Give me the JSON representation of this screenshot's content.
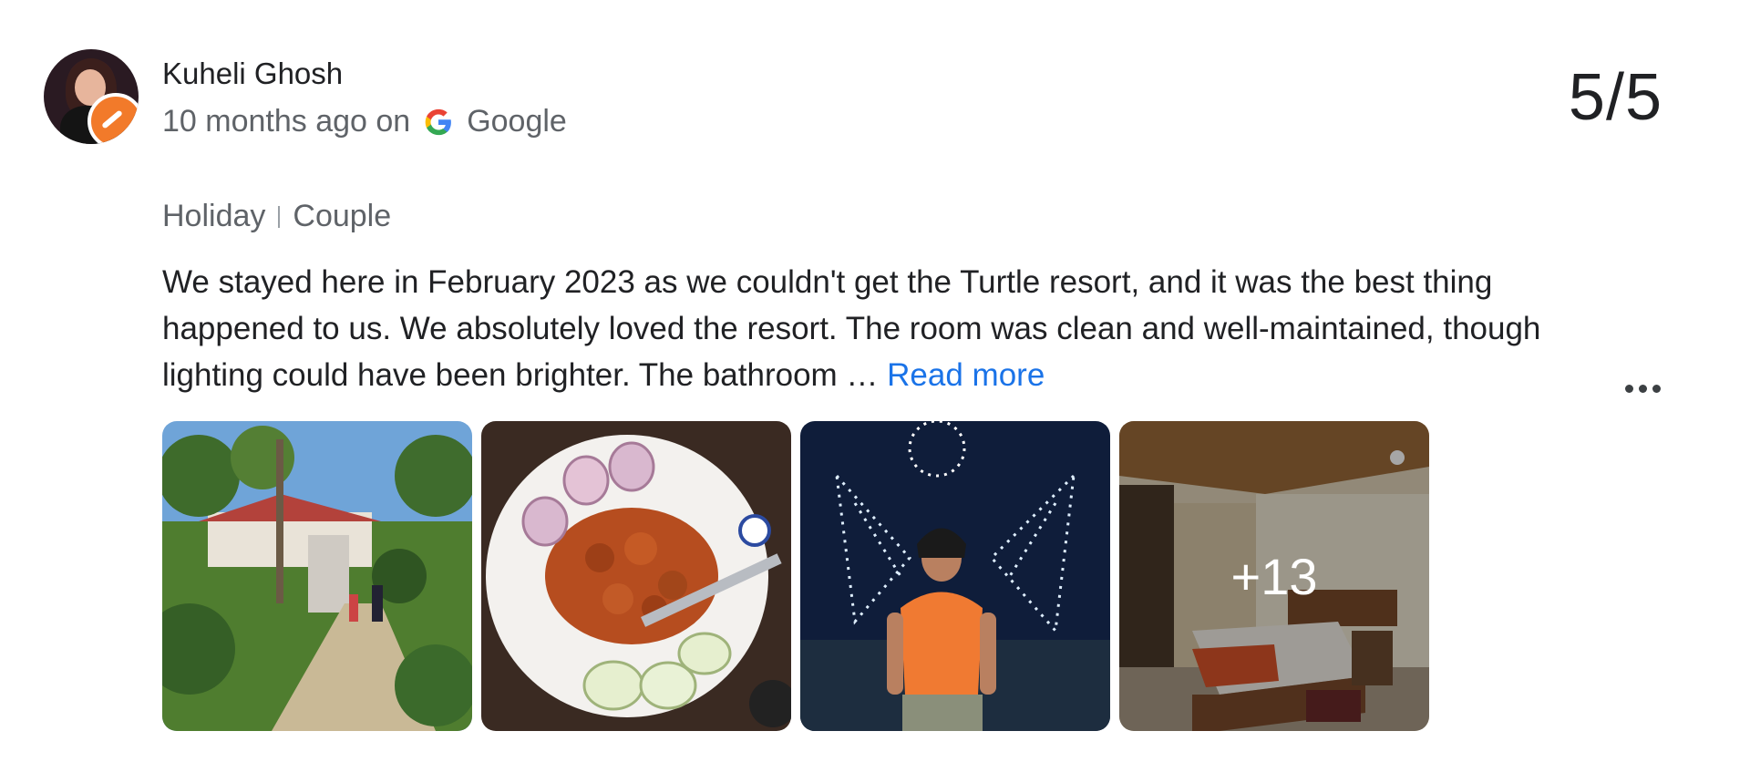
{
  "review": {
    "author": "Kuheli Ghosh",
    "time": "10 months ago on",
    "source": "Google",
    "rating": "5/5",
    "tags": [
      "Holiday",
      "Couple"
    ],
    "text": "We stayed here in February 2023 as we couldn't get the Turtle resort, and it was the best thing happened to us. We absolutely loved the resort. The room was clean and well-maintained, though lighting could have been brighter. The bathroom …",
    "read_more": "Read more",
    "more_photos": "+13"
  },
  "icons": {
    "google": "google-g-icon",
    "more": "more-horizontal-icon"
  },
  "colors": {
    "link": "#1a73e8",
    "muted": "#5f6368",
    "badge": "#f27a2a"
  }
}
